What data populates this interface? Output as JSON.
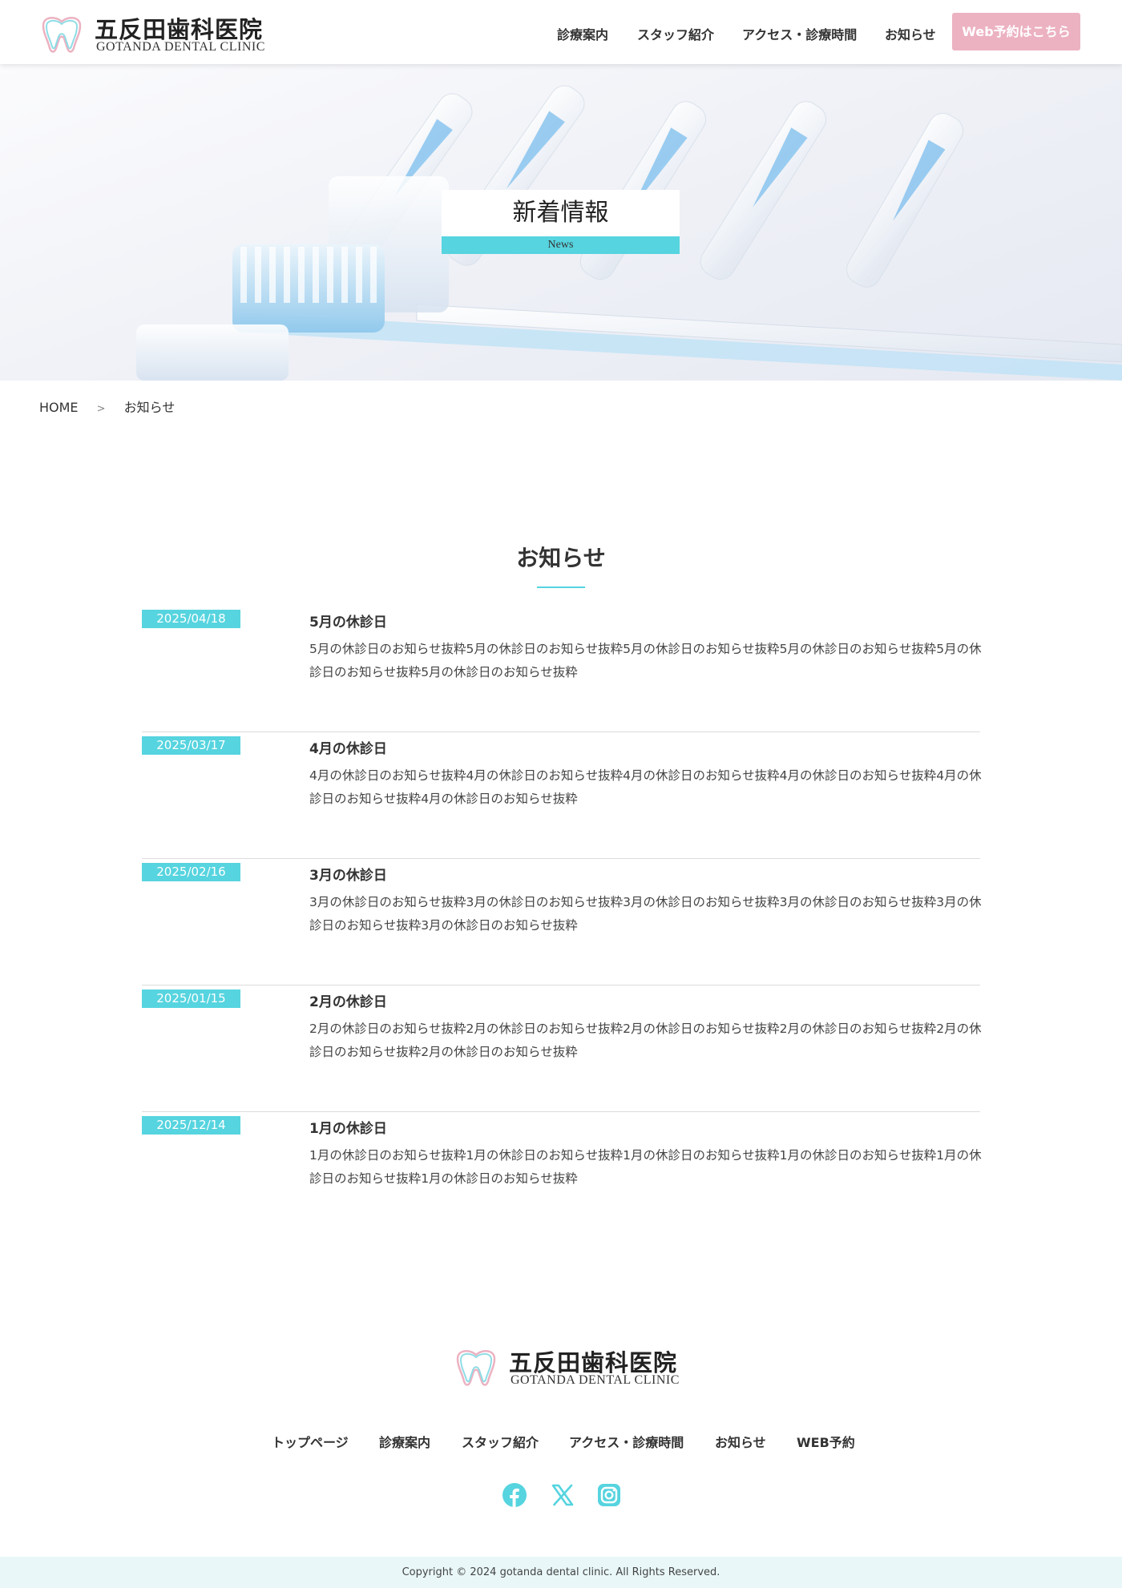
{
  "header": {
    "logo_jp": "五反田歯科医院",
    "logo_en": "GOTANDA DENTAL CLINIC",
    "nav": [
      "診療案内",
      "スタッフ紹介",
      "アクセス・診療時間",
      "お知らせ"
    ],
    "reserve_label": "Web予約はこちら"
  },
  "hero": {
    "title": "新着情報",
    "subtitle": "News"
  },
  "breadcrumb": {
    "home": "HOME",
    "separator": ">",
    "current": "お知らせ"
  },
  "section": {
    "title": "お知らせ"
  },
  "news": [
    {
      "date": "2025/04/18",
      "title": "5月の休診日",
      "body": "5月の休診日のお知らせ抜粋5月の休診日のお知らせ抜粋5月の休診日のお知らせ抜粋5月の休診日のお知らせ抜粋5月の休診日のお知らせ抜粋5月の休診日のお知らせ抜粋"
    },
    {
      "date": "2025/03/17",
      "title": "4月の休診日",
      "body": "4月の休診日のお知らせ抜粋4月の休診日のお知らせ抜粋4月の休診日のお知らせ抜粋4月の休診日のお知らせ抜粋4月の休診日のお知らせ抜粋4月の休診日のお知らせ抜粋"
    },
    {
      "date": "2025/02/16",
      "title": "3月の休診日",
      "body": "3月の休診日のお知らせ抜粋3月の休診日のお知らせ抜粋3月の休診日のお知らせ抜粋3月の休診日のお知らせ抜粋3月の休診日のお知らせ抜粋3月の休診日のお知らせ抜粋"
    },
    {
      "date": "2025/01/15",
      "title": "2月の休診日",
      "body": "2月の休診日のお知らせ抜粋2月の休診日のお知らせ抜粋2月の休診日のお知らせ抜粋2月の休診日のお知らせ抜粋2月の休診日のお知らせ抜粋2月の休診日のお知らせ抜粋"
    },
    {
      "date": "2025/12/14",
      "title": "1月の休診日",
      "body": "1月の休診日のお知らせ抜粋1月の休診日のお知らせ抜粋1月の休診日のお知らせ抜粋1月の休診日のお知らせ抜粋1月の休診日のお知らせ抜粋1月の休診日のお知らせ抜粋"
    }
  ],
  "footer": {
    "logo_jp": "五反田歯科医院",
    "logo_en": "GOTANDA DENTAL CLINIC",
    "nav": [
      "トップページ",
      "診療案内",
      "スタッフ紹介",
      "アクセス・診療時間",
      "お知らせ",
      "WEB予約"
    ],
    "social_icons": [
      "facebook-icon",
      "x-icon",
      "instagram-icon"
    ],
    "copyright": "Copyright © 2024 gotanda dental clinic. All Rights Reserved."
  },
  "colors": {
    "accent": "#56d4df",
    "reserve_button": "#ecb2c2",
    "footer_bg": "#e9f7f8"
  }
}
